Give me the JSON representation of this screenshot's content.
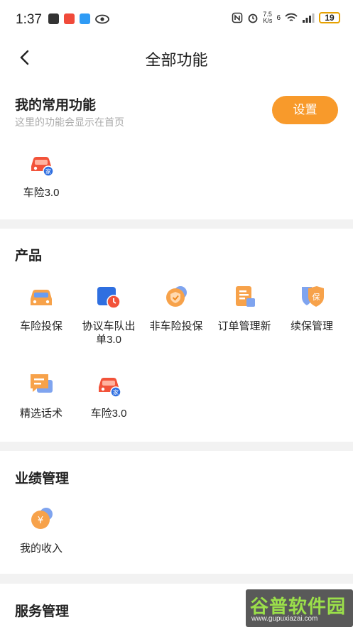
{
  "status_bar": {
    "time": "1:37",
    "net_speed": "7.5\nK/s",
    "network": "6",
    "battery": "19"
  },
  "nav": {
    "title": "全部功能"
  },
  "common": {
    "title": "我的常用功能",
    "subtitle": "这里的功能会显示在首页",
    "settings_label": "设置",
    "items": [
      {
        "label": "车险3.0",
        "icon": "car-insurance-icon"
      }
    ]
  },
  "products": {
    "title": "产品",
    "items": [
      {
        "label": "车险投保",
        "icon": "car-icon"
      },
      {
        "label": "协议车队出\n单3.0",
        "icon": "fleet-order-icon"
      },
      {
        "label": "非车险投保",
        "icon": "shield-check-icon"
      },
      {
        "label": "订单管理新",
        "icon": "order-doc-icon"
      },
      {
        "label": "续保管理",
        "icon": "renewal-shield-icon"
      },
      {
        "label": "精选话术",
        "icon": "chat-script-icon"
      },
      {
        "label": "车险3.0",
        "icon": "car-insurance-icon"
      }
    ]
  },
  "performance": {
    "title": "业绩管理",
    "items": [
      {
        "label": "我的收入",
        "icon": "income-coin-icon"
      }
    ]
  },
  "service": {
    "title": "服务管理"
  },
  "watermark": {
    "text": "谷普软件园",
    "url": "www.gupuxiazai.com"
  },
  "colors": {
    "accent": "#f89a2b",
    "background": "#f2f2f2",
    "card": "#ffffff"
  }
}
